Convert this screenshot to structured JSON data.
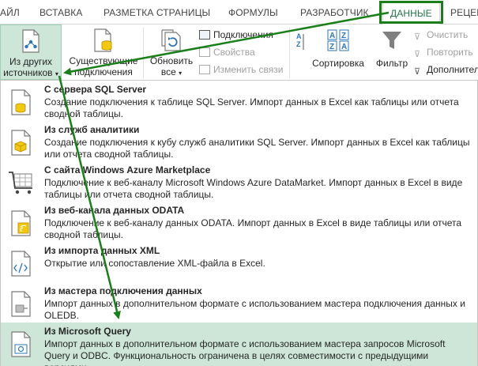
{
  "tabs": [
    {
      "label": "АЙЛ"
    },
    {
      "label": "ВСТАВКА"
    },
    {
      "label": "РАЗМЕТКА СТРАНИЦЫ"
    },
    {
      "label": "ФОРМУЛЫ"
    },
    {
      "label": "РАЗРАБОТЧИК"
    },
    {
      "label": "ДАННЫЕ"
    },
    {
      "label": "РЕЦЕН"
    }
  ],
  "ribbon": {
    "from_other_sources": {
      "line1": "Из других",
      "line2": "источников"
    },
    "existing_connections": {
      "line1": "Существующие",
      "line2": "подключения"
    },
    "refresh_all": {
      "line1": "Обновить",
      "line2": "все"
    },
    "connections": "Подключения",
    "properties": "Свойства",
    "edit_links": "Изменить связи",
    "sort": "Сортировка",
    "filter": "Фильтр",
    "clear": "Очистить",
    "reapply": "Повторить",
    "advanced": "Дополнител"
  },
  "menu": {
    "items": [
      {
        "title": "С сервера SQL Server",
        "desc": "Создание подключения к таблице SQL Server. Импорт данных в Excel как таблицы или отчета сводной таблицы."
      },
      {
        "title": "Из служб аналитики",
        "desc": "Создание подключения к кубу служб аналитики SQL Server. Импорт данных в Excel как таблицы или отчета сводной таблицы."
      },
      {
        "title": "С сайта Windows Azure Marketplace",
        "desc": "Подключение к веб-каналу Microsoft Windows Azure DataMarket. Импорт данных в Excel в виде таблицы или отчета сводной таблицы."
      },
      {
        "title": "Из веб-канала данных ODATA",
        "desc": "Подключение к веб-каналу данных ODATA. Импорт данных в Excel в виде таблицы или отчета сводной таблицы."
      },
      {
        "title": "Из импорта данных XML",
        "desc": "Открытие или сопоставление XML-файла в Excel."
      },
      {
        "title": "Из мастера подключения данных",
        "desc": "Импорт данных в дополнительном формате с использованием мастера подключения данных и OLEDB."
      },
      {
        "title": "Из Microsoft Query",
        "desc": "Импорт данных в дополнительном формате с использованием мастера запросов Microsoft Query и ODBC. Функциональность ограничена в целях совместимости с предыдущими версиями."
      }
    ]
  },
  "colors": {
    "accent": "#217346",
    "highlight_bg": "#cde6d7",
    "annotation_arrow": "#1a7f1a"
  }
}
